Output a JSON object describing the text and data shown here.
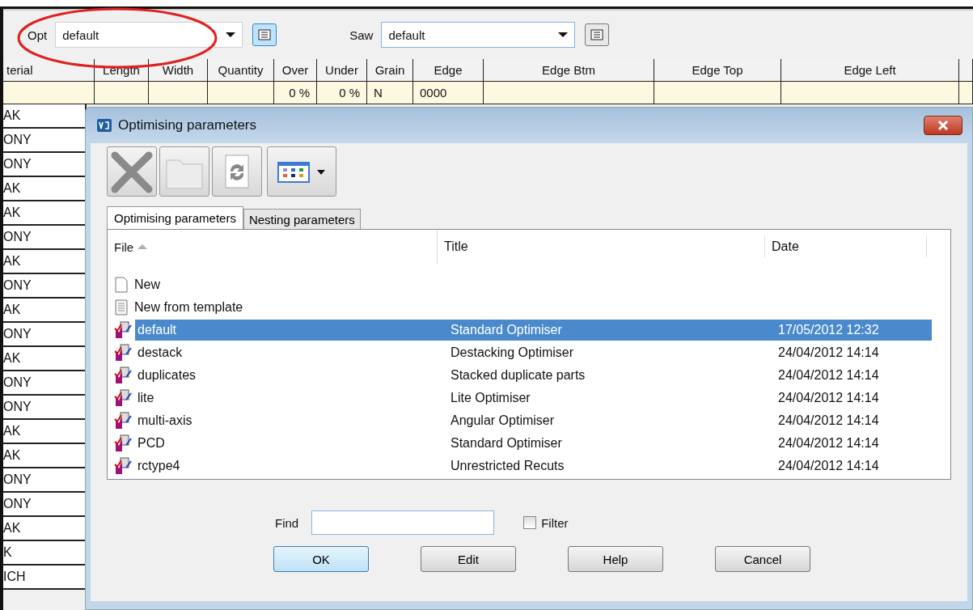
{
  "toolbar": {
    "opt": {
      "label": "Opt",
      "value": "default"
    },
    "saw": {
      "label": "Saw",
      "value": "default"
    }
  },
  "grid": {
    "columns": [
      {
        "label": "terial"
      },
      {
        "label": "Length"
      },
      {
        "label": "Width"
      },
      {
        "label": "Quantity"
      },
      {
        "label": "Over",
        "value": "0 %"
      },
      {
        "label": "Under",
        "value": "0 %"
      },
      {
        "label": "Grain",
        "value": "N"
      },
      {
        "label": "Edge",
        "value": "0000"
      },
      {
        "label": "Edge Btm"
      },
      {
        "label": "Edge Top"
      },
      {
        "label": "Edge Left"
      }
    ],
    "materials": [
      "AK",
      "ONY",
      "ONY",
      "AK",
      "AK",
      "ONY",
      "AK",
      "ONY",
      "AK",
      "ONY",
      "AK",
      "ONY",
      "ONY",
      "AK",
      "AK",
      "ONY",
      "ONY",
      "AK",
      "K",
      "ICH"
    ]
  },
  "dialog": {
    "title": "Optimising parameters",
    "tabs": [
      {
        "label": "Optimising parameters",
        "selected": true
      },
      {
        "label": "Nesting parameters",
        "selected": false
      }
    ],
    "columns": [
      {
        "label": "File",
        "sorted": true
      },
      {
        "label": "Title",
        "sorted": false
      },
      {
        "label": "Date",
        "sorted": false
      }
    ],
    "rows": [
      {
        "kind": "new",
        "file": "New",
        "selected": false
      },
      {
        "kind": "template",
        "file": "New from template",
        "selected": false
      },
      {
        "kind": "file",
        "file": "default",
        "title": "Standard Optimiser",
        "date": "17/05/2012 12:32",
        "selected": true
      },
      {
        "kind": "file",
        "file": "destack",
        "title": "Destacking Optimiser",
        "date": "24/04/2012 14:14",
        "selected": false
      },
      {
        "kind": "file",
        "file": "duplicates",
        "title": "Stacked duplicate parts",
        "date": "24/04/2012 14:14",
        "selected": false
      },
      {
        "kind": "file",
        "file": "lite",
        "title": "Lite Optimiser",
        "date": "24/04/2012 14:14",
        "selected": false
      },
      {
        "kind": "file",
        "file": "multi-axis",
        "title": "Angular Optimiser",
        "date": "24/04/2012 14:14",
        "selected": false
      },
      {
        "kind": "file",
        "file": "PCD",
        "title": "Standard Optimiser",
        "date": "24/04/2012 14:14",
        "selected": false
      },
      {
        "kind": "file",
        "file": "rctype4",
        "title": "Unrestricted Recuts",
        "date": "24/04/2012 14:14",
        "selected": false
      }
    ],
    "find": {
      "label": "Find"
    },
    "filter": {
      "label": "Filter",
      "checked": false
    },
    "buttons": [
      {
        "label": "OK",
        "default": true
      },
      {
        "label": "Edit",
        "default": false
      },
      {
        "label": "Help",
        "default": false
      },
      {
        "label": "Cancel",
        "default": false
      }
    ]
  }
}
